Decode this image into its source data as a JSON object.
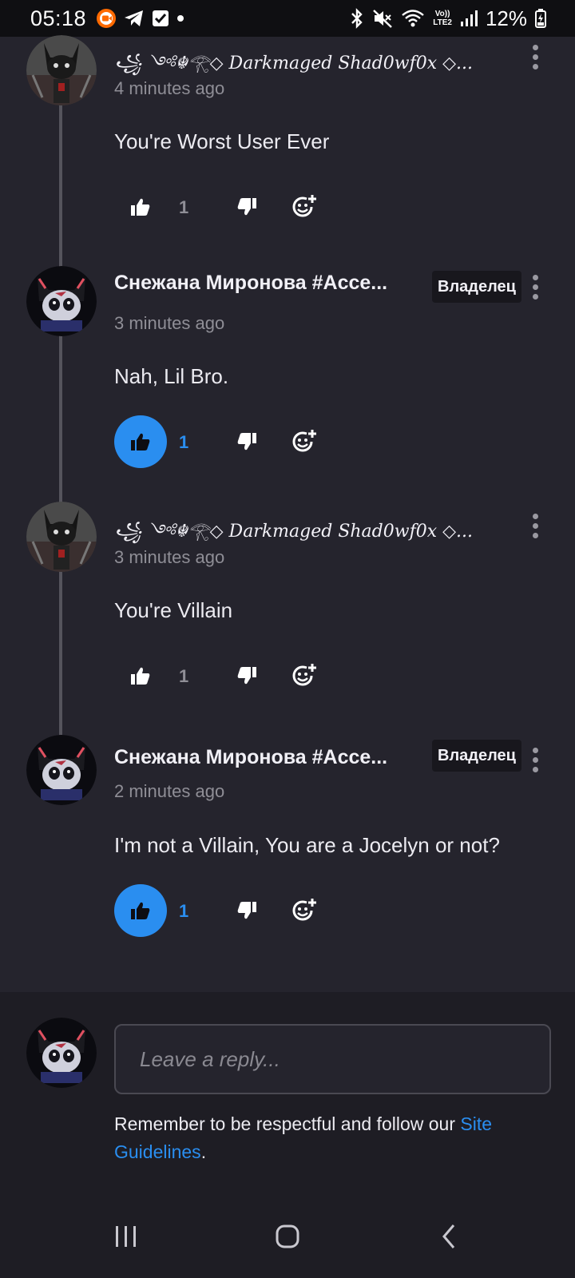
{
  "status_bar": {
    "time": "05:18",
    "battery": "12%",
    "icons": [
      "screen-recorder-icon",
      "telegram-icon",
      "checkbox-icon",
      "dot-icon",
      "bluetooth-icon",
      "mute-icon",
      "wifi-icon",
      "volte-icon",
      "signal-icon",
      "battery-charging-icon"
    ],
    "volte_label": "Vo))\nLTE2"
  },
  "comments": [
    {
      "author": "꧁ ༺☬𓂀◇ Darkmaged Shad0wf0x ◇...",
      "time": "4 minutes ago",
      "body": "You're Worst User Ever",
      "likes": "1",
      "liked": false,
      "owner": false
    },
    {
      "author": "Снежана Миронова #Acce...",
      "time": "3 minutes ago",
      "body": "Nah, Lil Bro.",
      "likes": "1",
      "liked": true,
      "owner": true,
      "badge": "Владелец"
    },
    {
      "author": "꧁ ༺☬𓂀◇ Darkmaged Shad0wf0x ◇...",
      "time": "3 minutes ago",
      "body": "You're Villain",
      "likes": "1",
      "liked": false,
      "owner": false
    },
    {
      "author": "Снежана Миронова #Acce...",
      "time": "2 minutes ago",
      "body": "I'm not a Villain, You are a Jocelyn or not?",
      "likes": "1",
      "liked": true,
      "owner": true,
      "badge": "Владелец"
    }
  ],
  "reply": {
    "placeholder": "Leave a reply...",
    "guidelines_text": "Remember to be respectful and follow our ",
    "guidelines_link": "Site Guidelines",
    "guidelines_end": "."
  },
  "colors": {
    "background": "#25242d",
    "accent": "#2a8ef0",
    "muted": "#8f8e96"
  }
}
